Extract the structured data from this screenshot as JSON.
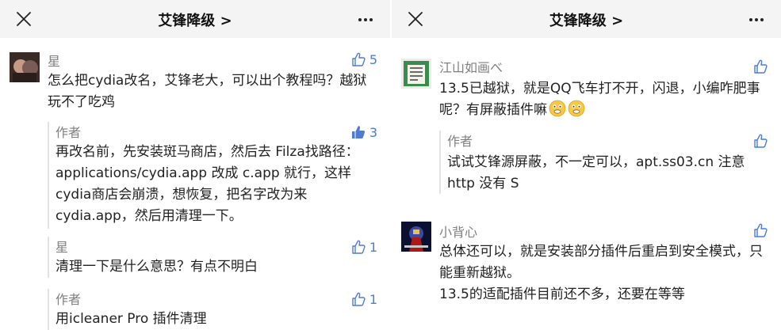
{
  "left": {
    "nav": {
      "title": "艾锋降级 >"
    },
    "comment": {
      "author": "星",
      "likes": "5",
      "text": "怎么把cydia改名，艾锋老大，可以出个教程吗？越狱玩不了吃鸡"
    },
    "replies": [
      {
        "author": "作者",
        "likes": "3",
        "text": "再改名前，先安装斑马商店，然后去 Filza找路径：applications/cydia.app 改成 c.app 就行，这样cydia商店会崩溃，想恢复，把名字改为来 cydia.app，然后用清理一下。"
      },
      {
        "author": "星",
        "likes": "1",
        "text": "清理一下是什么意思？有点不明白"
      },
      {
        "author": "作者",
        "likes": "1",
        "text": "用icleaner Pro 插件清理"
      }
    ]
  },
  "right": {
    "nav": {
      "title": "艾锋降级 >"
    },
    "comments": [
      {
        "author": "江山如画べ",
        "text": "13.5已越狱，就是QQ飞车打不开，闪退，小编咋肥事呢？有屏蔽插件嘛",
        "reply": {
          "author": "作者",
          "text": "试试艾锋源屏蔽，不一定可以，apt.ss03.cn 注意 http 没有 S"
        }
      },
      {
        "author": "小背心",
        "text": "总体还可以，就是安装部分插件后重启到安全模式，只能重新越狱。",
        "text2": "13.5的适配插件目前还不多，还要在等等"
      }
    ]
  },
  "colors": {
    "like_active": "#4d7bd6",
    "like_outline": "#4d7bd6",
    "muted_text": "#7f7f7f",
    "navbar_bg": "#f4f4f4",
    "reply_rule": "#e3e3e3"
  },
  "icons": {
    "close": "close-icon",
    "more": "more-icon",
    "like": "thumbs-up-icon",
    "like_filled": "thumbs-up-filled-icon",
    "emoji": "grimace-emoji-icon"
  }
}
